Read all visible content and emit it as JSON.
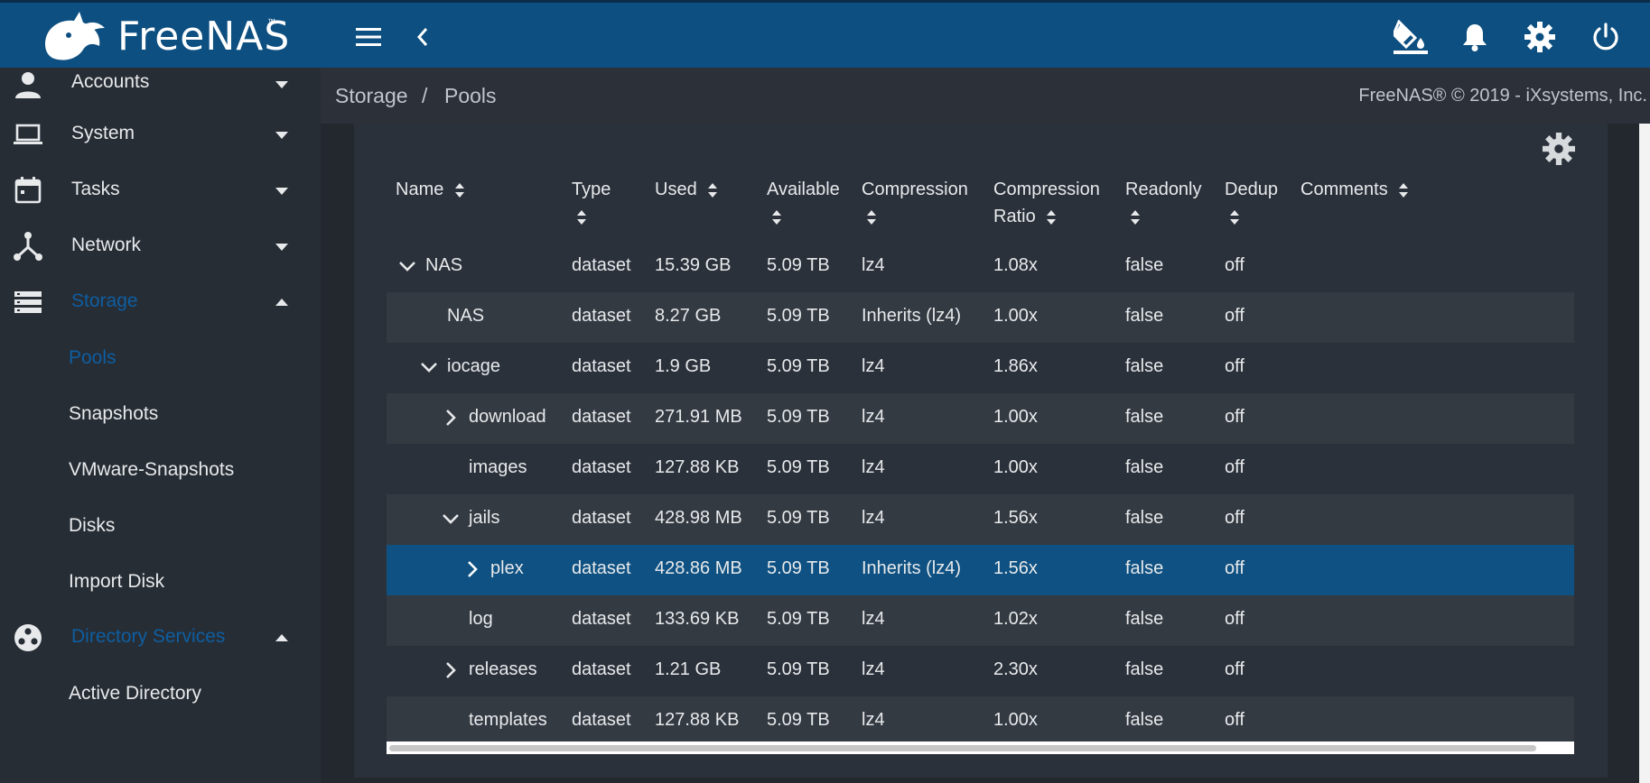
{
  "brand": {
    "name": "FreeNAS",
    "tm": "™"
  },
  "topbar": {
    "menu_icon": "menu-icon",
    "back_icon": "chevron-left-icon",
    "theme_icon": "paint-bucket-icon",
    "notifications_icon": "bell-icon",
    "settings_icon": "gear-icon",
    "power_icon": "power-icon"
  },
  "sidebar": {
    "items": [
      {
        "label": "Accounts",
        "icon": "accounts-icon"
      },
      {
        "label": "System",
        "icon": "laptop-icon"
      },
      {
        "label": "Tasks",
        "icon": "calendar-icon"
      },
      {
        "label": "Network",
        "icon": "network-icon"
      },
      {
        "label": "Storage",
        "icon": "storage-icon"
      },
      {
        "label": "Directory Services",
        "icon": "directory-services-icon"
      }
    ],
    "storage_sub": [
      "Pools",
      "Snapshots",
      "VMware-Snapshots",
      "Disks",
      "Import Disk"
    ],
    "directory_sub": [
      "Active Directory"
    ]
  },
  "breadcrumb": {
    "section": "Storage",
    "separator": "/",
    "page": "Pools"
  },
  "copyright": "FreeNAS® © 2019 - iXsystems, Inc.",
  "table": {
    "headers": {
      "name": "Name",
      "type": "Type",
      "used": "Used",
      "available": "Available",
      "compression": "Compression",
      "ratio_1": "Compression",
      "ratio_2": "Ratio",
      "readonly": "Readonly",
      "dedup": "Dedup",
      "comments": "Comments"
    },
    "rows": [
      {
        "name": "NAS",
        "type": "dataset",
        "used": "15.39 GB",
        "available": "5.09 TB",
        "compression": "lz4",
        "ratio": "1.08x",
        "readonly": "false",
        "dedup": "off"
      },
      {
        "name": "NAS",
        "type": "dataset",
        "used": "8.27 GB",
        "available": "5.09 TB",
        "compression": "Inherits (lz4)",
        "ratio": "1.00x",
        "readonly": "false",
        "dedup": "off"
      },
      {
        "name": "iocage",
        "type": "dataset",
        "used": "1.9 GB",
        "available": "5.09 TB",
        "compression": "lz4",
        "ratio": "1.86x",
        "readonly": "false",
        "dedup": "off"
      },
      {
        "name": "download",
        "type": "dataset",
        "used": "271.91 MB",
        "available": "5.09 TB",
        "compression": "lz4",
        "ratio": "1.00x",
        "readonly": "false",
        "dedup": "off"
      },
      {
        "name": "images",
        "type": "dataset",
        "used": "127.88 KB",
        "available": "5.09 TB",
        "compression": "lz4",
        "ratio": "1.00x",
        "readonly": "false",
        "dedup": "off"
      },
      {
        "name": "jails",
        "type": "dataset",
        "used": "428.98 MB",
        "available": "5.09 TB",
        "compression": "lz4",
        "ratio": "1.56x",
        "readonly": "false",
        "dedup": "off"
      },
      {
        "name": "plex",
        "type": "dataset",
        "used": "428.86 MB",
        "available": "5.09 TB",
        "compression": "Inherits (lz4)",
        "ratio": "1.56x",
        "readonly": "false",
        "dedup": "off"
      },
      {
        "name": "log",
        "type": "dataset",
        "used": "133.69 KB",
        "available": "5.09 TB",
        "compression": "lz4",
        "ratio": "1.02x",
        "readonly": "false",
        "dedup": "off"
      },
      {
        "name": "releases",
        "type": "dataset",
        "used": "1.21 GB",
        "available": "5.09 TB",
        "compression": "lz4",
        "ratio": "2.30x",
        "readonly": "false",
        "dedup": "off"
      },
      {
        "name": "templates",
        "type": "dataset",
        "used": "127.88 KB",
        "available": "5.09 TB",
        "compression": "lz4",
        "ratio": "1.00x",
        "readonly": "false",
        "dedup": "off"
      }
    ]
  },
  "colors": {
    "accent": "#0d4f80",
    "selected_row": "#0e5182",
    "active_nav": "#0e5ea1",
    "background": "#23282f"
  }
}
